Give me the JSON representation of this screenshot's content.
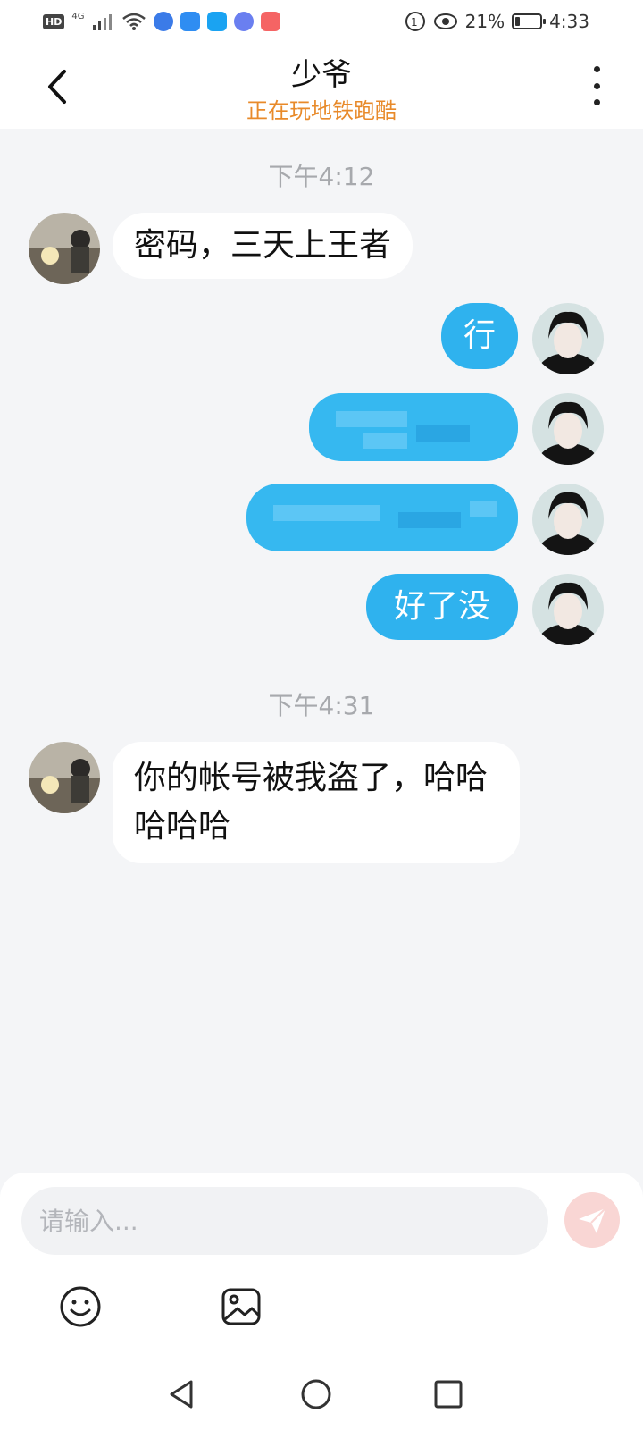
{
  "status_bar": {
    "hd": "HD",
    "network": "4G",
    "battery": "21%",
    "battery_level": 0.21,
    "time": "4:33"
  },
  "header": {
    "title": "少爷",
    "subtitle": "正在玩地铁跑酷"
  },
  "messages": [
    {
      "type": "timestamp",
      "text": "下午4:12"
    },
    {
      "type": "incoming",
      "text": "密码，三天上王者"
    },
    {
      "type": "outgoing",
      "text": "行"
    },
    {
      "type": "outgoing_blurred",
      "text": ""
    },
    {
      "type": "outgoing_blurred",
      "text": ""
    },
    {
      "type": "outgoing",
      "text": "好了没"
    },
    {
      "type": "timestamp",
      "text": "下午4:31"
    },
    {
      "type": "incoming",
      "text": "你的帐号被我盗了，哈哈哈哈哈"
    }
  ],
  "composer": {
    "placeholder": "请输入..."
  },
  "colors": {
    "outgoing_bubble": "#2fb2ee",
    "incoming_bubble": "#ffffff",
    "subtitle": "#e88a2a",
    "send_button": "#f9d6d4"
  },
  "icons": {
    "back": "back-arrow-icon",
    "more": "more-vertical-icon",
    "send": "send-icon",
    "emoji": "emoji-icon",
    "image": "image-icon",
    "nav_back": "nav-back-icon",
    "nav_home": "nav-home-icon",
    "nav_recents": "nav-recents-icon"
  }
}
